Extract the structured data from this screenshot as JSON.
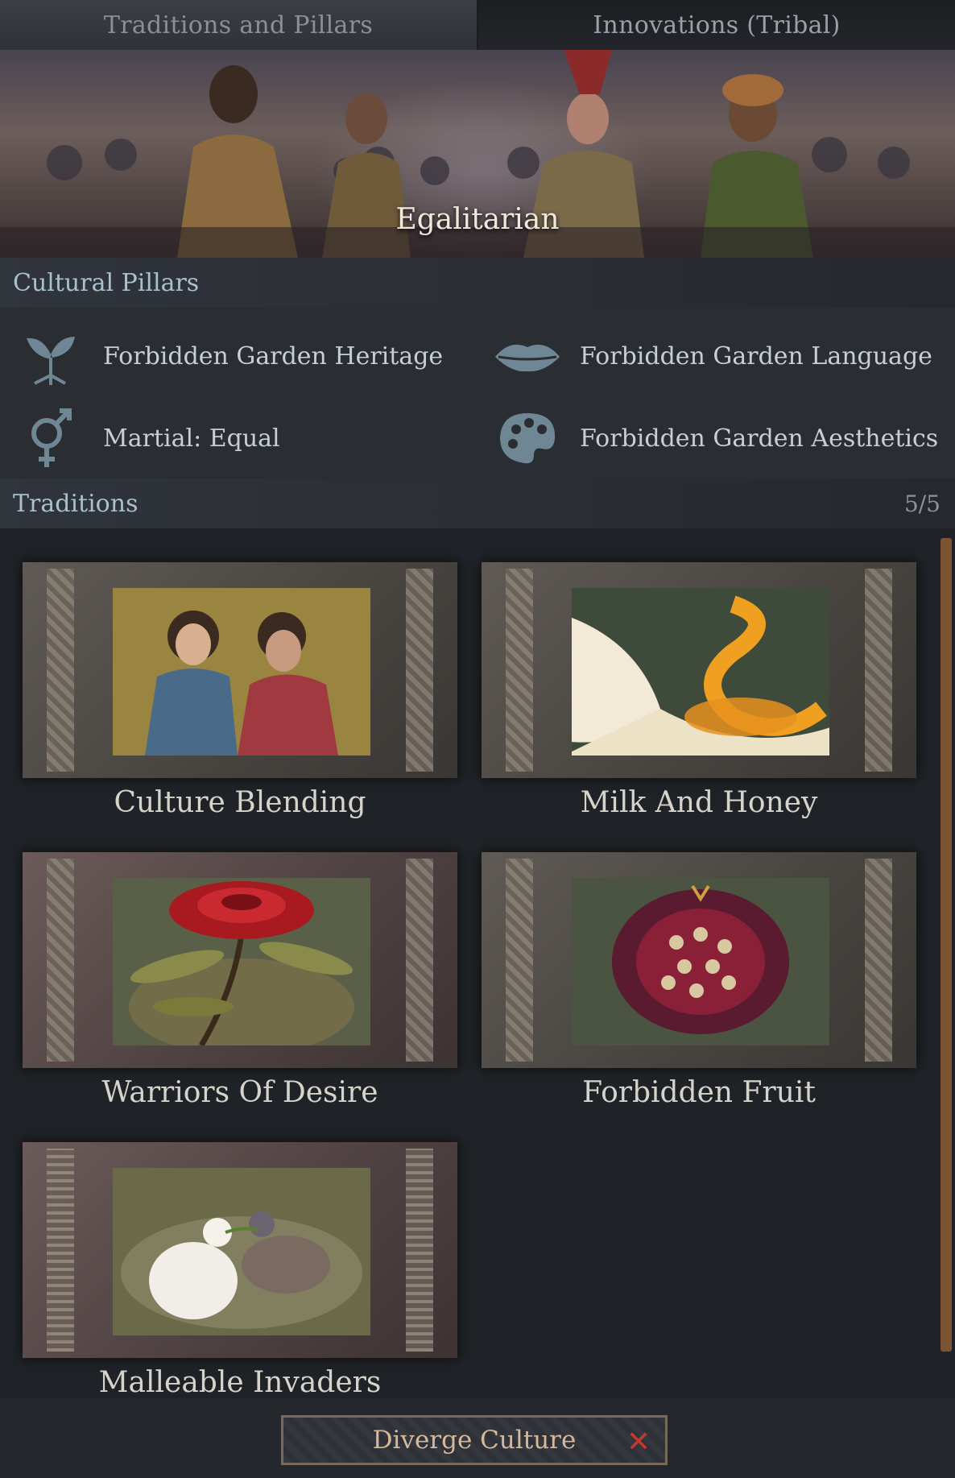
{
  "tabs": [
    {
      "label": "Traditions and Pillars",
      "active": true
    },
    {
      "label": "Innovations (Tribal)",
      "active": false
    }
  ],
  "banner": {
    "title": "Egalitarian"
  },
  "pillars_section": {
    "title": "Cultural Pillars"
  },
  "pillars": [
    {
      "label": "Forbidden Garden Heritage",
      "icon": "heritage-sprout-icon"
    },
    {
      "label": "Forbidden Garden Language",
      "icon": "lips-icon"
    },
    {
      "label": "Martial: Equal",
      "icon": "gender-symbol-icon"
    },
    {
      "label": "Forbidden Garden Aesthetics",
      "icon": "palette-icon"
    }
  ],
  "traditions_section": {
    "title": "Traditions",
    "count": "5/5"
  },
  "traditions": [
    {
      "name": "Culture Blending"
    },
    {
      "name": "Milk And Honey"
    },
    {
      "name": "Warriors Of Desire"
    },
    {
      "name": "Forbidden Fruit"
    },
    {
      "name": "Malleable Invaders"
    }
  ],
  "bottom": {
    "diverge_label": "Diverge Culture",
    "close_icon": "close-x-icon"
  },
  "colors": {
    "accent": "#a9c1cc",
    "button_text": "#d7b89a",
    "close": "#c23a2e",
    "scrollbar": "#7d5432"
  }
}
